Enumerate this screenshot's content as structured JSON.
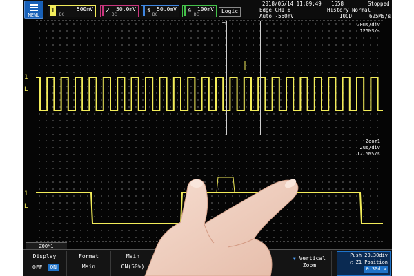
{
  "menu": {
    "label": "MENU"
  },
  "channels": [
    {
      "num": "1",
      "scale": "500mV",
      "coupling": "DC"
    },
    {
      "num": "2",
      "scale": "50.0mV",
      "coupling": "DC"
    },
    {
      "num": "3",
      "scale": "50.0mV",
      "coupling": "DC"
    },
    {
      "num": "4",
      "scale": "100mV",
      "coupling": "DC"
    }
  ],
  "logic": {
    "label": "Logic"
  },
  "status": {
    "datetime": "2018/05/14 11:09:49",
    "count": "1558",
    "state": "Stopped",
    "trigger_line1": "Edge CH1 ±",
    "trigger_line2": "Auto -560mV",
    "history_label": "History",
    "history_mode": "Normal",
    "history_count": "10CD",
    "sample_rate": "625MS/s"
  },
  "main": {
    "timebase": "20us/div",
    "rate": "125MS/s",
    "ch_marker": "1",
    "level_marker": "L",
    "trigger_marker": "T"
  },
  "zoom": {
    "title": "Zoom1",
    "timebase": "2us/div",
    "rate": "12.5MS/s",
    "ch_marker": "1",
    "level_marker": "L"
  },
  "zoom_tab": {
    "label": "ZOOM1"
  },
  "softkeys": {
    "display": {
      "label": "Display",
      "off": "OFF",
      "on": "ON"
    },
    "format": {
      "label": "Format",
      "value": "Main"
    },
    "main": {
      "label": "Main",
      "value": "ON(50%)"
    },
    "vertical": {
      "label1": "Vertical",
      "label2": "Zoom"
    },
    "position": {
      "push": "Push",
      "push_value": "20.30div",
      "title": "Z1 Position",
      "value": "0.30div"
    }
  },
  "colors": {
    "ch1": "#f2ec5a",
    "ch2": "#c8367e",
    "ch3": "#3f86e0",
    "ch4": "#44c24a",
    "accent": "#1f73c9"
  }
}
